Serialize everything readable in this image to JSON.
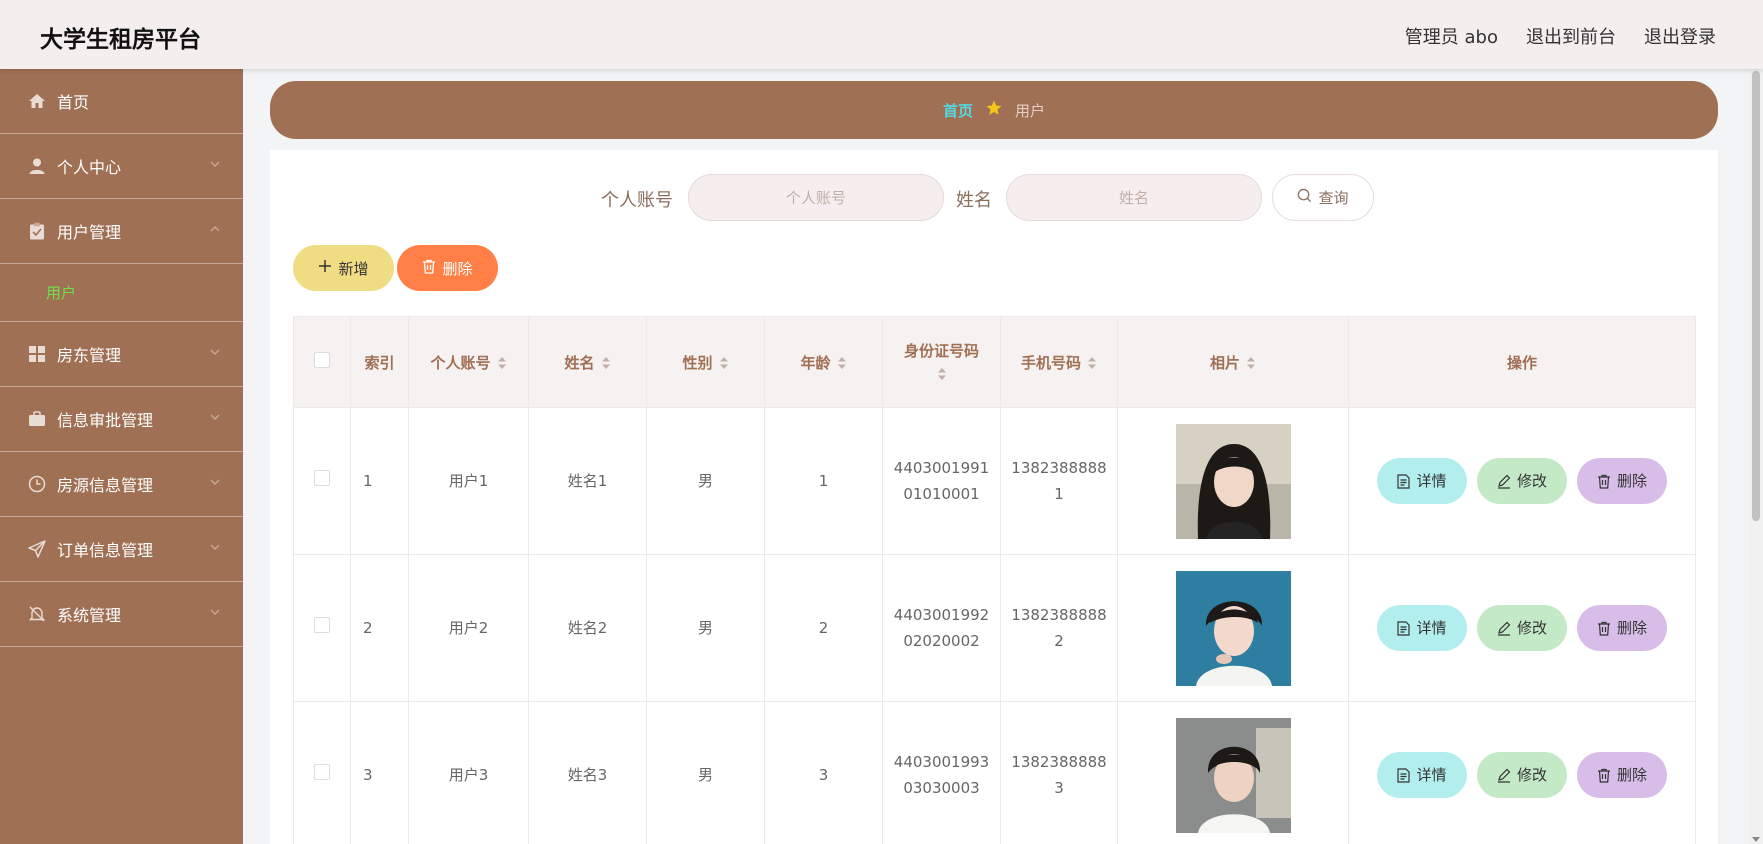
{
  "header": {
    "title": "大学生租房平台",
    "admin_label": "管理员 abo",
    "to_front": "退出到前台",
    "logout": "退出登录"
  },
  "sidebar": {
    "items": [
      {
        "label": "首页",
        "icon": "home-icon"
      },
      {
        "label": "个人中心",
        "icon": "user-icon"
      },
      {
        "label": "用户管理",
        "icon": "clipboard-icon",
        "expanded": true
      },
      {
        "label": "房东管理",
        "icon": "grid-icon"
      },
      {
        "label": "信息审批管理",
        "icon": "briefcase-icon"
      },
      {
        "label": "房源信息管理",
        "icon": "clock-icon"
      },
      {
        "label": "订单信息管理",
        "icon": "send-icon"
      },
      {
        "label": "系统管理",
        "icon": "bell-off-icon"
      }
    ],
    "subitem": "用户"
  },
  "breadcrumb": {
    "home": "首页",
    "current": "用户"
  },
  "search": {
    "account_label": "个人账号",
    "account_placeholder": "个人账号",
    "name_label": "姓名",
    "name_placeholder": "姓名",
    "query_button": "查询"
  },
  "actions": {
    "add": "新增",
    "delete": "删除"
  },
  "table": {
    "columns": [
      "索引",
      "个人账号",
      "姓名",
      "性别",
      "年龄",
      "身份证号码",
      "手机号码",
      "相片",
      "操作"
    ],
    "rows": [
      {
        "index": "1",
        "account": "用户1",
        "name": "姓名1",
        "gender": "男",
        "age": "1",
        "id_line1": "4403001991",
        "id_line2": "01010001",
        "phone_line1": "1382388888",
        "phone_line2": "1"
      },
      {
        "index": "2",
        "account": "用户2",
        "name": "姓名2",
        "gender": "男",
        "age": "2",
        "id_line1": "4403001992",
        "id_line2": "02020002",
        "phone_line1": "1382388888",
        "phone_line2": "2"
      },
      {
        "index": "3",
        "account": "用户3",
        "name": "姓名3",
        "gender": "男",
        "age": "3",
        "id_line1": "4403001993",
        "id_line2": "03030003",
        "phone_line1": "1382388888",
        "phone_line2": "3"
      }
    ],
    "row_ops": {
      "detail": "详情",
      "edit": "修改",
      "delete": "删除"
    }
  },
  "colors": {
    "brand": "#a07055",
    "breadcrumb_home": "#53d8e0",
    "submenu_active": "#6fe04b",
    "add_button": "#f0dd83",
    "delete_button": "#ff7f46",
    "detail_button": "#b3eeee",
    "edit_button": "#c4e9c7",
    "row_delete_button": "#d8bde8"
  }
}
